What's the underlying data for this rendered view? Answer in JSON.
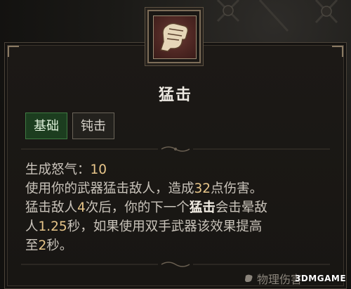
{
  "skill": {
    "name": "猛击",
    "icon": "fist-icon",
    "tags": [
      "基础",
      "钝击"
    ]
  },
  "description": {
    "resource_label": "生成怒气：",
    "resource_value": "10",
    "line1_a": "使用你的武器猛击敌人，造成",
    "line1_num": "32",
    "line1_b": "点伤害。",
    "line2_a": "猛击敌人",
    "line2_num": "4",
    "line2_b": "次后，你的下一个",
    "line2_kw": "猛击",
    "line2_c": "会击晕敌",
    "line3_a": "人",
    "line3_num": "1.25",
    "line3_b": "秒，如果使用双手武器该效果提高",
    "line4_a": "至",
    "line4_num": "2",
    "line4_b": "秒。"
  },
  "footer": {
    "label": "物理伤害",
    "icon": "small-fist-icon"
  },
  "watermark": "3DMGAME",
  "colors": {
    "basic_tag_bg": "#1c3d1f",
    "number_highlight": "#e8c68a",
    "icon_bg": "#4d2622"
  }
}
